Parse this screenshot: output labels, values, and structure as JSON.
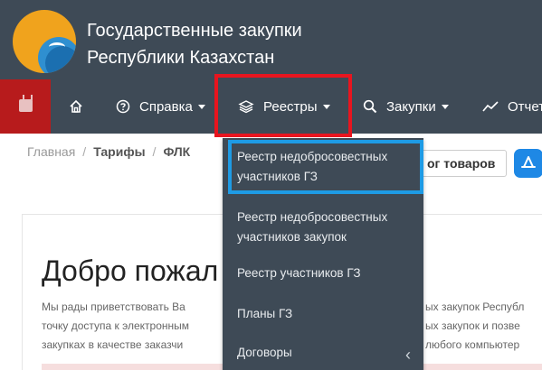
{
  "header": {
    "title_line1": "Государственные закупки",
    "title_line2": "Республики Казахстан"
  },
  "nav": {
    "items": [
      {
        "label": "Справка"
      },
      {
        "label": "Реестры"
      },
      {
        "label": "Закупки"
      },
      {
        "label": "Отчет"
      }
    ]
  },
  "breadcrumb": [
    "Главная",
    "Тарифы",
    "ФЛК"
  ],
  "catalog_button": "ог товаров",
  "dropdown": {
    "items": [
      {
        "line1": "Реестр недобросовестных",
        "line2": "участников ГЗ"
      },
      {
        "line1": "Реестр недобросовестных",
        "line2": "участников закупок"
      },
      {
        "line1": "Реестр участников ГЗ"
      },
      {
        "line1": "Планы ГЗ"
      },
      {
        "line1": "Договоры"
      }
    ]
  },
  "content": {
    "welcome": "Добро пожал",
    "para_left": [
      "Мы рады приветствовать Ва",
      "точку доступа к электронным",
      "закупках в качестве заказчи"
    ],
    "para_right": [
      "ых закупок Республ",
      "ых закупок и позве",
      "любого компьютер"
    ]
  },
  "colors": {
    "header_bg": "#3e4a56",
    "youtube_red": "#b71b1c",
    "highlight_red": "#e8151f",
    "highlight_blue": "#1e9be5"
  }
}
